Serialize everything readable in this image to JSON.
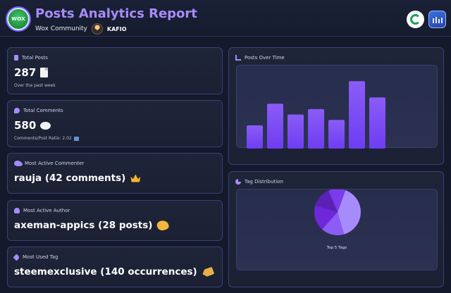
{
  "header": {
    "logo_text": "WOX",
    "title": "Posts Analytics Report",
    "community": "Wox Community",
    "username": "KAFIO"
  },
  "cards": {
    "total_posts": {
      "label": "Total Posts",
      "value": "287",
      "note": "Over the past week",
      "icon": "document-icon"
    },
    "total_comments": {
      "label": "Total Comments",
      "value": "580",
      "note": "Comments/Post Ratio: 2.02",
      "icon": "speech-bubble-icon"
    },
    "most_active_commenter": {
      "label": "Most Active Commenter",
      "value": "rauja (42 comments)",
      "icon": "crown-icon"
    },
    "most_active_author": {
      "label": "Most Active Author",
      "value": "axeman-appics (28 posts)",
      "icon": "writing-hand-icon"
    },
    "most_used_tag": {
      "label": "Most Used Tag",
      "value": "steemexclusive (140 occurrences)",
      "icon": "tag-icon"
    }
  },
  "posts_over_time": {
    "label": "Posts Over Time"
  },
  "tag_distribution": {
    "label": "Tag Distribution",
    "caption": "Top 5 Tags"
  },
  "chart_data": [
    {
      "type": "bar",
      "title": "Posts Over Time",
      "categories": [
        "",
        "",
        "",
        "",
        "",
        "",
        ""
      ],
      "values": [
        30,
        58,
        44,
        51,
        37,
        87,
        66
      ],
      "ylim": [
        0,
        100
      ],
      "grid": false,
      "color": "#7c4dff"
    },
    {
      "type": "pie",
      "title": "Tag Distribution",
      "caption": "Top 5 Tags",
      "values": [
        40,
        16,
        18,
        14,
        12
      ],
      "colors": [
        "#a78bfa",
        "#8b5cf6",
        "#6d28d9",
        "#5b21b6",
        "#7c3aed"
      ]
    }
  ]
}
